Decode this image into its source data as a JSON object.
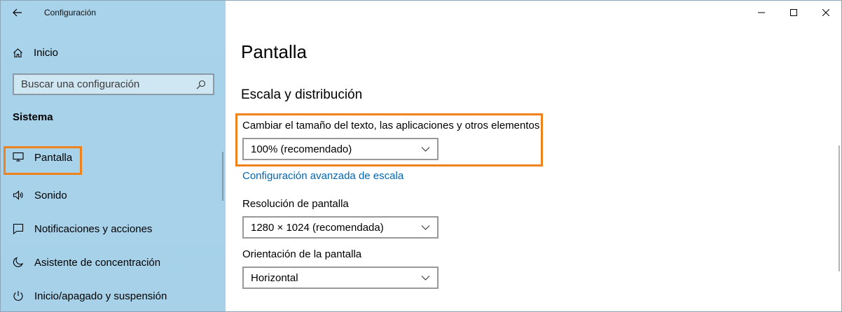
{
  "window": {
    "title": "Configuración",
    "controls": [
      "minimize",
      "maximize",
      "close"
    ]
  },
  "sidebar": {
    "home_label": "Inicio",
    "search_placeholder": "Buscar una configuración",
    "section_label": "Sistema",
    "items": [
      {
        "label": "Pantalla",
        "icon": "monitor-icon",
        "active": true
      },
      {
        "label": "Sonido",
        "icon": "speaker-icon",
        "active": false
      },
      {
        "label": "Notificaciones y acciones",
        "icon": "notification-icon",
        "active": false
      },
      {
        "label": "Asistente de concentración",
        "icon": "moon-icon",
        "active": false
      },
      {
        "label": "Inicio/apagado y suspensión",
        "icon": "power-icon",
        "active": false
      }
    ]
  },
  "main": {
    "page_title": "Pantalla",
    "section_title": "Escala y distribución",
    "scale": {
      "label": "Cambiar el tamaño del texto, las aplicaciones y otros elementos",
      "value": "100% (recomendado)"
    },
    "advanced_link": "Configuración avanzada de escala",
    "resolution": {
      "label": "Resolución de pantalla",
      "value": "1280 × 1024 (recomendada)"
    },
    "orientation": {
      "label": "Orientación de la pantalla",
      "value": "Horizontal"
    }
  },
  "colors": {
    "sidebar_bg": "#a9d3ea",
    "highlight": "#f0821e",
    "link": "#0066b4"
  }
}
